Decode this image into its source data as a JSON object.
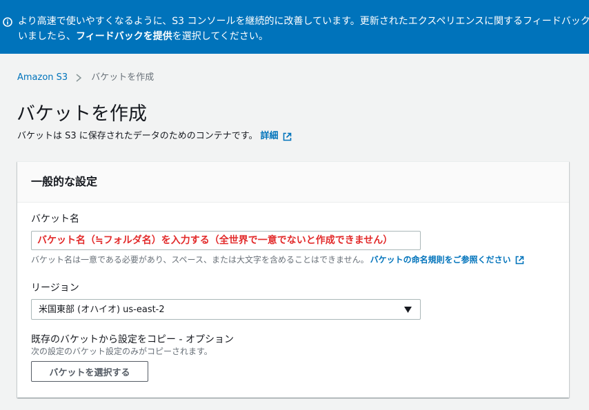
{
  "banner": {
    "line1": "より高速で使いやすくなるように、S3 コンソールを継続的に改善しています。更新されたエクスペリエンスに関するフィードバックがありましたら、",
    "line2_prefix": "いましたら、",
    "feedback_link": "フィードバックを提供",
    "line2_suffix": "を選択してください。",
    "line1_display": "より高速で使いやすくなるように、S3 コンソールを継続的に改善しています。更新されたエクスペリエンスに関するフィードバック",
    "icon": "info-icon"
  },
  "breadcrumb": {
    "root": "Amazon S3",
    "current": "バケットを作成"
  },
  "page": {
    "title": "バケットを作成",
    "description": "バケットは S3 に保存されたデータのためのコンテナです。",
    "learn_more": "詳細"
  },
  "panel": {
    "title": "一般的な設定",
    "bucket_name_label": "バケット名",
    "bucket_name_value": "バケット名（≒フォルダ名）を入力する（全世界で一意でないと作成できません）",
    "bucket_name_hint": "バケット名は一意である必要があり、スペース、または大文字を含めることはできません。",
    "bucket_name_rules_link": "バケットの命名規則をご参照ください",
    "region_label": "リージョン",
    "region_value": "米国東部 (オハイオ) us-east-2",
    "copy_label": "既存のバケットから設定をコピー - オプション",
    "copy_desc": "次の設定のバケット設定のみがコピーされます。",
    "choose_bucket_button": "バケットを選択する"
  },
  "colors": {
    "banner_bg": "#0073bb",
    "link": "#0073bb",
    "annotation_red": "#e22b2b"
  }
}
